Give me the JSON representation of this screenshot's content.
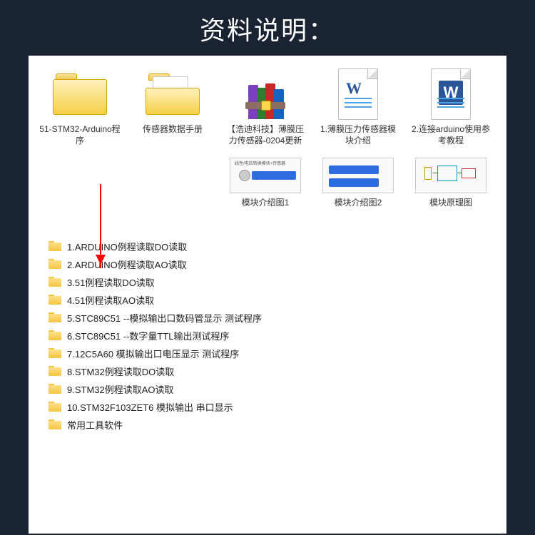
{
  "header": "资料说明：",
  "top_row": [
    {
      "label": "51-STM32-Arduino程序",
      "icon": "folder"
    },
    {
      "label": "传感器数据手册",
      "icon": "folder-doc"
    },
    {
      "label": "【浩迪科技】薄膜压力传感器-0204更新",
      "icon": "rar"
    },
    {
      "label": "1.薄膜压力传感器模块介绍",
      "icon": "word1"
    },
    {
      "label": "2.连接arduino使用参考教程",
      "icon": "word2"
    }
  ],
  "thumb_row": [
    {
      "label": "模块介绍图1",
      "caption": "线性/电压转换模块+传感器"
    },
    {
      "label": "模块介绍图2",
      "caption": ""
    },
    {
      "label": "模块原理图",
      "caption": ""
    }
  ],
  "folders": [
    "1.ARDUINO例程读取DO读取",
    "2.ARDUINO例程读取AO读取",
    "3.51例程读取DO读取",
    "4.51例程读取AO读取",
    "5.STC89C51 --模拟输出口数码管显示 测试程序",
    "6.STC89C51 --数字量TTL输出测试程序",
    "7.12C5A60 模拟输出口电压显示  测试程序",
    "8.STM32例程读取DO读取",
    "9.STM32例程读取AO读取",
    "10.STM32F103ZET6 模拟输出 串口显示",
    "常用工具软件"
  ]
}
